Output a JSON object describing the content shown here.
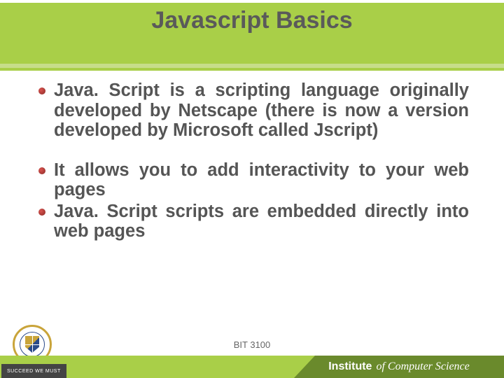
{
  "title": "Javascript Basics",
  "bullets": [
    {
      "text": "Java. Script is a scripting language originally developed by Netscape (there is now a version developed by Microsoft called Jscript)"
    },
    {
      "text": "It allows you to add interactivity to your web pages"
    },
    {
      "text": " Java. Script scripts are embedded directly into web pages"
    }
  ],
  "course_code": "BIT 3100",
  "footer": {
    "motto": "SUCCEED WE MUST",
    "institute_prefix": "Institute",
    "institute_rest": "of Computer Science"
  },
  "colors": {
    "accent_green": "#a9cf48",
    "accent_green_light": "#c7dd8a",
    "accent_green_dark": "#6a8a2c",
    "text_gray": "#555555",
    "bullet_red": "#8b2a26"
  }
}
